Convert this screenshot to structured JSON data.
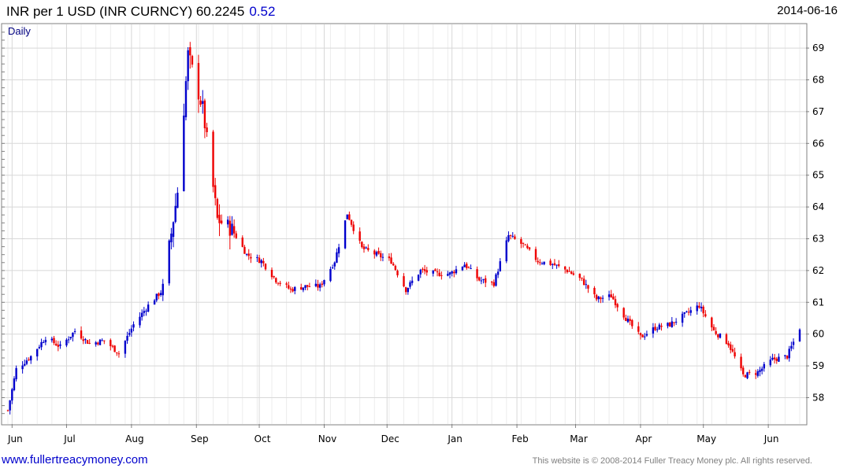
{
  "header": {
    "title": "INR per 1 USD (INR CURNCY) 60.2245",
    "change": "0.52",
    "date": "2014-06-16"
  },
  "period_label": "Daily",
  "footer": {
    "site": "www.fullertreacymoney.com",
    "copyright": "This website is © 2008-2014 Fuller Treacy Money plc. All rights reserved."
  },
  "colors": {
    "up": "#0000cc",
    "down": "#ee0000",
    "grid": "#d8d8d8",
    "axis": "#808080"
  },
  "chart_data": {
    "type": "candlestick",
    "y_axis_side": "right",
    "ylim": [
      57.3,
      69.8
    ],
    "y_ticks": [
      58,
      59,
      60,
      61,
      62,
      63,
      64,
      65,
      66,
      67,
      68,
      69
    ],
    "x_ticks": [
      "Jun",
      "Jul",
      "Aug",
      "Sep",
      "Oct",
      "Nov",
      "Dec",
      "Jan",
      "Feb",
      "Mar",
      "Apr",
      "May",
      "Jun"
    ],
    "grid": true,
    "last_close": 60.2245,
    "change": 0.52,
    "approx_closes": [
      {
        "date": "2013-06-03",
        "close": 57.6
      },
      {
        "date": "2013-06-07",
        "close": 58.9
      },
      {
        "date": "2013-06-14",
        "close": 59.3
      },
      {
        "date": "2013-06-21",
        "close": 59.9
      },
      {
        "date": "2013-06-28",
        "close": 59.6
      },
      {
        "date": "2013-07-05",
        "close": 60.1
      },
      {
        "date": "2013-07-12",
        "close": 59.7
      },
      {
        "date": "2013-07-19",
        "close": 59.8
      },
      {
        "date": "2013-07-26",
        "close": 59.4
      },
      {
        "date": "2013-08-02",
        "close": 60.3
      },
      {
        "date": "2013-08-09",
        "close": 60.9
      },
      {
        "date": "2013-08-16",
        "close": 61.4
      },
      {
        "date": "2013-08-23",
        "close": 64.5
      },
      {
        "date": "2013-08-28",
        "close": 68.8
      },
      {
        "date": "2013-09-04",
        "close": 67.1
      },
      {
        "date": "2013-09-11",
        "close": 63.6
      },
      {
        "date": "2013-09-18",
        "close": 63.3
      },
      {
        "date": "2013-09-25",
        "close": 62.5
      },
      {
        "date": "2013-10-02",
        "close": 62.3
      },
      {
        "date": "2013-10-09",
        "close": 61.7
      },
      {
        "date": "2013-10-16",
        "close": 61.4
      },
      {
        "date": "2013-10-23",
        "close": 61.5
      },
      {
        "date": "2013-10-30",
        "close": 61.5
      },
      {
        "date": "2013-11-06",
        "close": 62.3
      },
      {
        "date": "2013-11-12",
        "close": 63.8
      },
      {
        "date": "2013-11-19",
        "close": 62.7
      },
      {
        "date": "2013-11-26",
        "close": 62.5
      },
      {
        "date": "2013-12-03",
        "close": 62.3
      },
      {
        "date": "2013-12-10",
        "close": 61.4
      },
      {
        "date": "2013-12-17",
        "close": 62.0
      },
      {
        "date": "2013-12-24",
        "close": 61.9
      },
      {
        "date": "2013-12-31",
        "close": 61.9
      },
      {
        "date": "2014-01-07",
        "close": 62.2
      },
      {
        "date": "2014-01-14",
        "close": 61.7
      },
      {
        "date": "2014-01-21",
        "close": 61.6
      },
      {
        "date": "2014-01-28",
        "close": 63.1
      },
      {
        "date": "2014-02-04",
        "close": 62.8
      },
      {
        "date": "2014-02-11",
        "close": 62.3
      },
      {
        "date": "2014-02-18",
        "close": 62.2
      },
      {
        "date": "2014-02-25",
        "close": 62.0
      },
      {
        "date": "2014-03-04",
        "close": 61.7
      },
      {
        "date": "2014-03-11",
        "close": 61.1
      },
      {
        "date": "2014-03-18",
        "close": 61.2
      },
      {
        "date": "2014-03-25",
        "close": 60.5
      },
      {
        "date": "2014-04-01",
        "close": 59.9
      },
      {
        "date": "2014-04-08",
        "close": 60.2
      },
      {
        "date": "2014-04-15",
        "close": 60.3
      },
      {
        "date": "2014-04-22",
        "close": 60.6
      },
      {
        "date": "2014-04-29",
        "close": 60.9
      },
      {
        "date": "2014-05-06",
        "close": 60.1
      },
      {
        "date": "2014-05-13",
        "close": 59.7
      },
      {
        "date": "2014-05-20",
        "close": 58.7
      },
      {
        "date": "2014-05-27",
        "close": 58.8
      },
      {
        "date": "2014-06-03",
        "close": 59.2
      },
      {
        "date": "2014-06-10",
        "close": 59.3
      },
      {
        "date": "2014-06-16",
        "close": 60.2
      }
    ]
  }
}
